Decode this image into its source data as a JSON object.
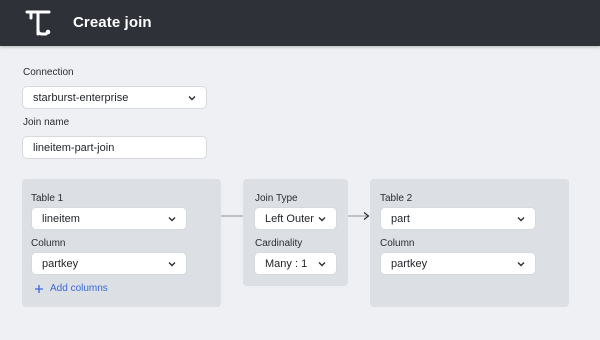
{
  "header": {
    "title": "Create join",
    "logo_icon": "starburst-t-logo"
  },
  "form": {
    "connection_label": "Connection",
    "connection_value": "starburst-enterprise",
    "join_name_label": "Join name",
    "join_name_value": "lineitem-part-join"
  },
  "table1": {
    "heading": "Table 1",
    "table_value": "lineitem",
    "column_label": "Column",
    "column_value": "partkey",
    "add_columns_label": "Add columns"
  },
  "join": {
    "type_label": "Join Type",
    "type_value": "Left Outer",
    "cardinality_label": "Cardinality",
    "cardinality_value": "Many : 1"
  },
  "table2": {
    "heading": "Table 2",
    "table_value": "part",
    "column_label": "Column",
    "column_value": "partkey"
  },
  "colors": {
    "header_bg": "#2e3138",
    "page_bg": "#eef0f3",
    "panel_bg": "#dcdfe4",
    "link": "#3b6ad6"
  }
}
